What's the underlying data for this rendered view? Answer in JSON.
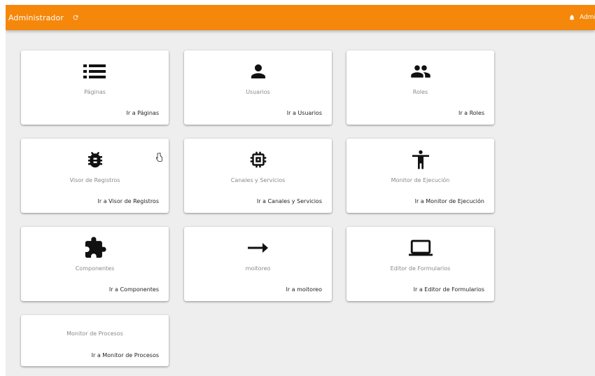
{
  "header": {
    "title": "Administrador",
    "refresh_icon": "refresh-icon",
    "user_label": "Administrador",
    "bell_icon": "bell-icon",
    "accent_color": "#f5870a"
  },
  "cards": [
    {
      "title": "Páginas",
      "link": "Ir a Páginas",
      "icon": "list-icon"
    },
    {
      "title": "Usuarios",
      "link": "Ir a Usuarios",
      "icon": "person-icon"
    },
    {
      "title": "Roles",
      "link": "Ir a Roles",
      "icon": "group-icon"
    },
    {
      "title": "Visor de Registros",
      "link": "Ir a Visor de Registros",
      "icon": "bug-icon"
    },
    {
      "title": "Canales y Servicios",
      "link": "Ir a Canales y Servicios",
      "icon": "chip-icon"
    },
    {
      "title": "Monitor de Ejecución",
      "link": "Ir a Monitor de Ejecución",
      "icon": "person-standing-icon"
    },
    {
      "title": "Componentes",
      "link": "Ir a Componentes",
      "icon": "puzzle-icon"
    },
    {
      "title": "moitoreo",
      "link": "Ir a moitoreo",
      "icon": "arrow-right-icon"
    },
    {
      "title": "Editor de Formularios",
      "link": "Ir a Editor de Formularios",
      "icon": "laptop-icon"
    },
    {
      "title": "Monitor de Procesos",
      "link": "Ir a Monitor de Procesos",
      "icon": ""
    }
  ]
}
